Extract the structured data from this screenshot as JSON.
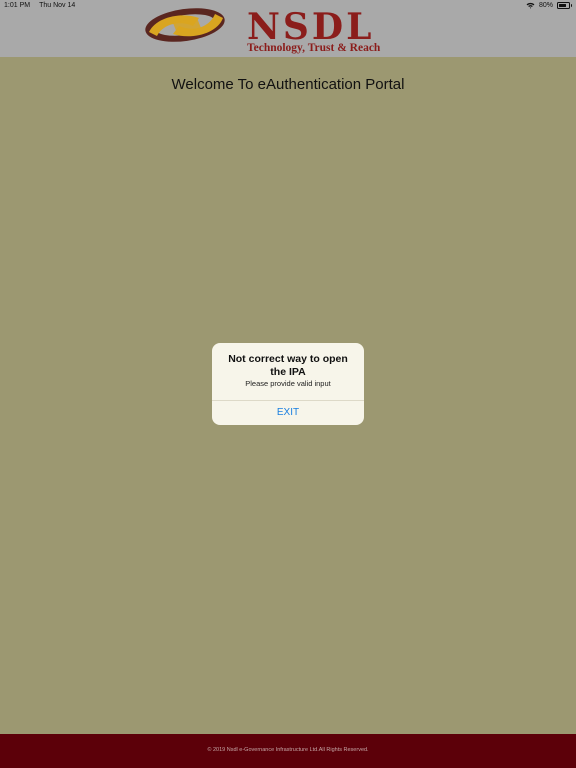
{
  "status_bar": {
    "time": "1:01 PM",
    "date": "Thu Nov 14",
    "battery_percent": "80%",
    "battery_level": 0.8,
    "wifi_icon": "wifi-icon",
    "battery_icon": "battery-icon"
  },
  "header": {
    "logo_name": "NSDL",
    "logo_tagline": "Technology, Trust & Reach",
    "logo_icon": "nsdl-logo-icon",
    "logo_colors": {
      "gold": "#d9a520",
      "maroon": "#8b1d1b",
      "brown": "#5a2620"
    }
  },
  "main": {
    "title": "Welcome To eAuthentication Portal"
  },
  "alert": {
    "title": "Not correct way to open the IPA",
    "message": "Please provide valid input",
    "exit_label": "EXIT",
    "button_color": "#1a7fe0"
  },
  "footer": {
    "text": "© 2019 Nsdl e-Governance Infrastructure Ltd.All Rights Reserved."
  },
  "colors": {
    "background": "#9c9871",
    "header": "#a9a9a9",
    "footer": "#5c0009"
  }
}
